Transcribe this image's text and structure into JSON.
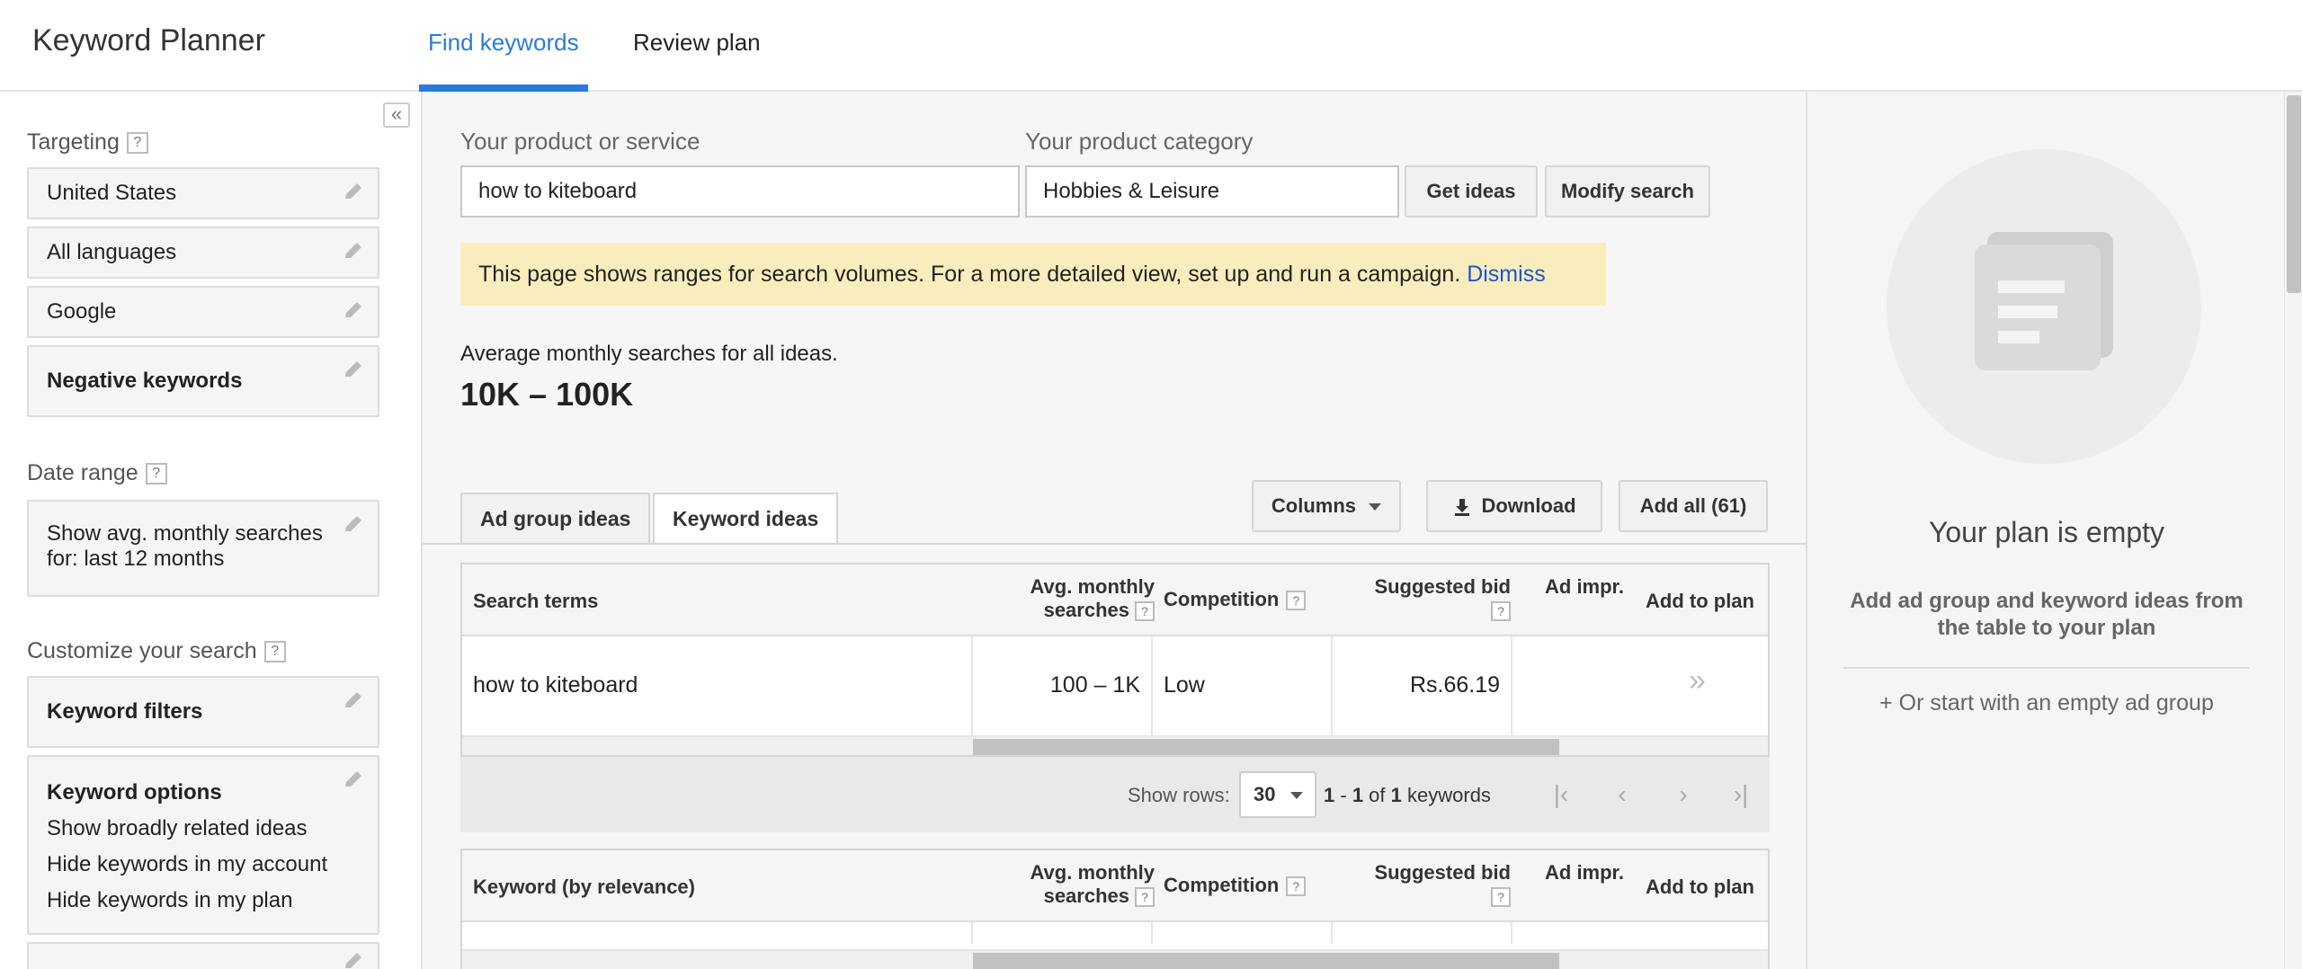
{
  "header": {
    "app_title": "Keyword Planner",
    "tabs": [
      {
        "label": "Find keywords",
        "active": true
      },
      {
        "label": "Review plan",
        "active": false
      }
    ]
  },
  "sidebar": {
    "collapse_icon": "double-chevron-left-icon",
    "targeting": {
      "title": "Targeting",
      "help": "?",
      "items": [
        "United States",
        "All languages",
        "Google",
        "Negative keywords"
      ]
    },
    "date_range": {
      "title": "Date range",
      "help": "?",
      "line1": "Show avg. monthly searches",
      "line2": "for: last 12 months"
    },
    "customize": {
      "title": "Customize your search",
      "help": "?",
      "keyword_filters": "Keyword filters",
      "keyword_options_title": "Keyword options",
      "keyword_options": [
        "Show broadly related ideas",
        "Hide keywords in my account",
        "Hide keywords in my plan"
      ]
    }
  },
  "search": {
    "product_label": "Your product or service",
    "product_value": "how to kiteboard",
    "category_label": "Your product category",
    "category_value": "Hobbies & Leisure",
    "get_ideas": "Get ideas",
    "modify_search": "Modify search"
  },
  "notice": {
    "text": "This page shows ranges for search volumes. For a more detailed view, set up and run a campaign.",
    "dismiss": "Dismiss"
  },
  "summary": {
    "label": "Average monthly searches for all ideas.",
    "value": "10K – 100K"
  },
  "ideas_tabs": [
    {
      "label": "Ad group ideas",
      "active": false
    },
    {
      "label": "Keyword ideas",
      "active": true
    }
  ],
  "toolbar": {
    "columns": "Columns",
    "download": "Download",
    "add_all": "Add all (61)"
  },
  "search_terms_table": {
    "headers": {
      "term": "Search terms",
      "avg1": "Avg. monthly",
      "avg2": "searches",
      "competition": "Competition",
      "bid": "Suggested bid",
      "impr": "Ad impr.",
      "add": "Add to plan"
    },
    "rows": [
      {
        "term": "how to kiteboard",
        "avg": "100 – 1K",
        "competition": "Low",
        "bid": "Rs.66.19",
        "add": "»"
      }
    ]
  },
  "pager": {
    "show_rows_label": "Show rows:",
    "rows_value": "30",
    "range_bold1": "1",
    "range_sep": " - ",
    "range_bold2": "1",
    "range_of": " of ",
    "range_bold3": "1",
    "range_suffix": " keywords"
  },
  "keyword_table": {
    "headers": {
      "term": "Keyword (by relevance)",
      "avg1": "Avg. monthly",
      "avg2": "searches",
      "competition": "Competition",
      "bid": "Suggested bid",
      "impr": "Ad impr.",
      "add": "Add to plan"
    }
  },
  "plan": {
    "title": "Your plan is empty",
    "desc": "Add ad group and keyword ideas from the table to your plan",
    "link": "+ Or start with an empty ad group"
  },
  "colors": {
    "accent": "#2b7bd6",
    "notice_bg": "#f9edbe",
    "link": "#1a55d1"
  }
}
